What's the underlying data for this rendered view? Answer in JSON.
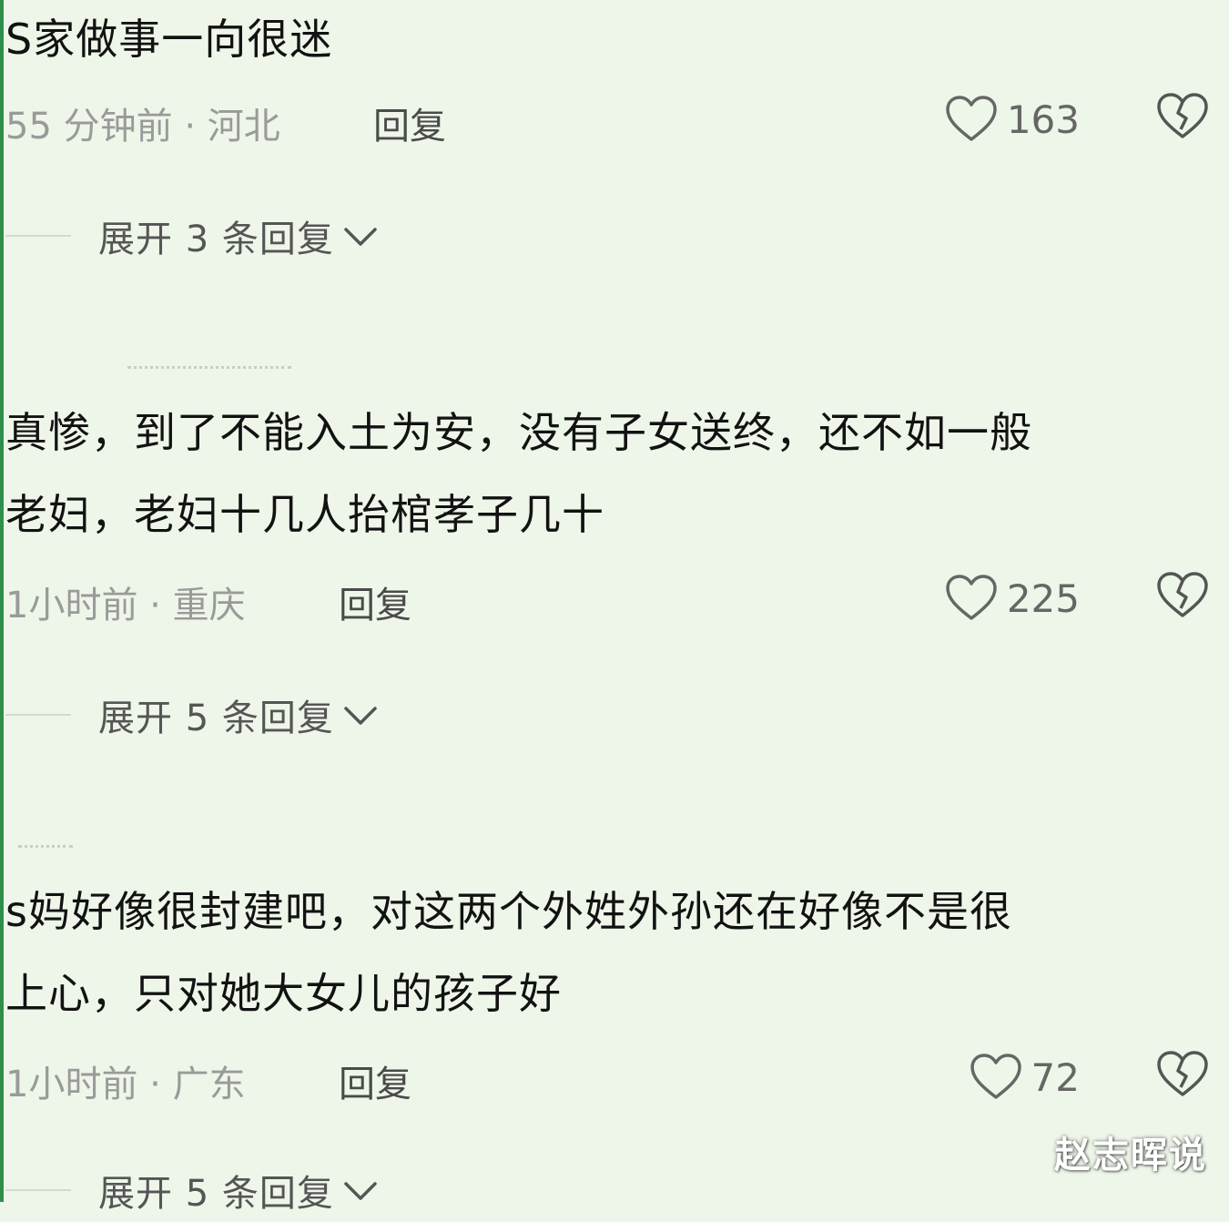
{
  "comments": [
    {
      "text": "S家做事一向很迷",
      "time": "55 分钟前",
      "location": "河北",
      "reply_label": "回复",
      "likes": "163",
      "expand_label": "展开 3 条回复"
    },
    {
      "text": "真惨，到了不能入土为安，没有子女送终，还不如一般\n老妇，老妇十几人抬棺孝子几十",
      "time": "1小时前",
      "location": "重庆",
      "reply_label": "回复",
      "likes": "225",
      "expand_label": "展开 5 条回复"
    },
    {
      "text": "s妈好像很封建吧，对这两个外姓外孙还在好像不是很\n上心，只对她大女儿的孩子好",
      "time": "1小时前",
      "location": "广东",
      "reply_label": "回复",
      "likes": "72",
      "expand_label": "展开 5 条回复"
    }
  ],
  "separator": "·",
  "watermark": "赵志晖说",
  "icons": {
    "like": "heart-outline-icon",
    "dislike": "broken-heart-icon",
    "expand": "chevron-down-icon"
  },
  "colors": {
    "background": "#eef6ea",
    "text": "#121212",
    "meta": "#9a9a9a",
    "accent_edge": "#2f8f4a"
  }
}
